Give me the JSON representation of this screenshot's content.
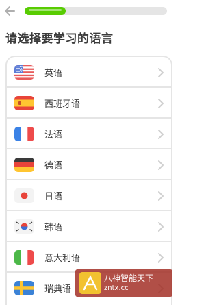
{
  "header": {
    "back_icon": "arrow-left-icon",
    "progress_fraction": 0.29,
    "progress_color": "#58cc02"
  },
  "page": {
    "title": "请选择要学习的语言"
  },
  "languages": [
    {
      "label": "英语",
      "flag": "us"
    },
    {
      "label": "西班牙语",
      "flag": "es"
    },
    {
      "label": "法语",
      "flag": "fr"
    },
    {
      "label": "德语",
      "flag": "de"
    },
    {
      "label": "日语",
      "flag": "jp"
    },
    {
      "label": "韩语",
      "flag": "kr"
    },
    {
      "label": "意大利语",
      "flag": "it"
    },
    {
      "label": "瑞典语",
      "flag": "se"
    }
  ],
  "watermark": {
    "line1": "八神智能天下",
    "line2": "zntx.cc"
  }
}
